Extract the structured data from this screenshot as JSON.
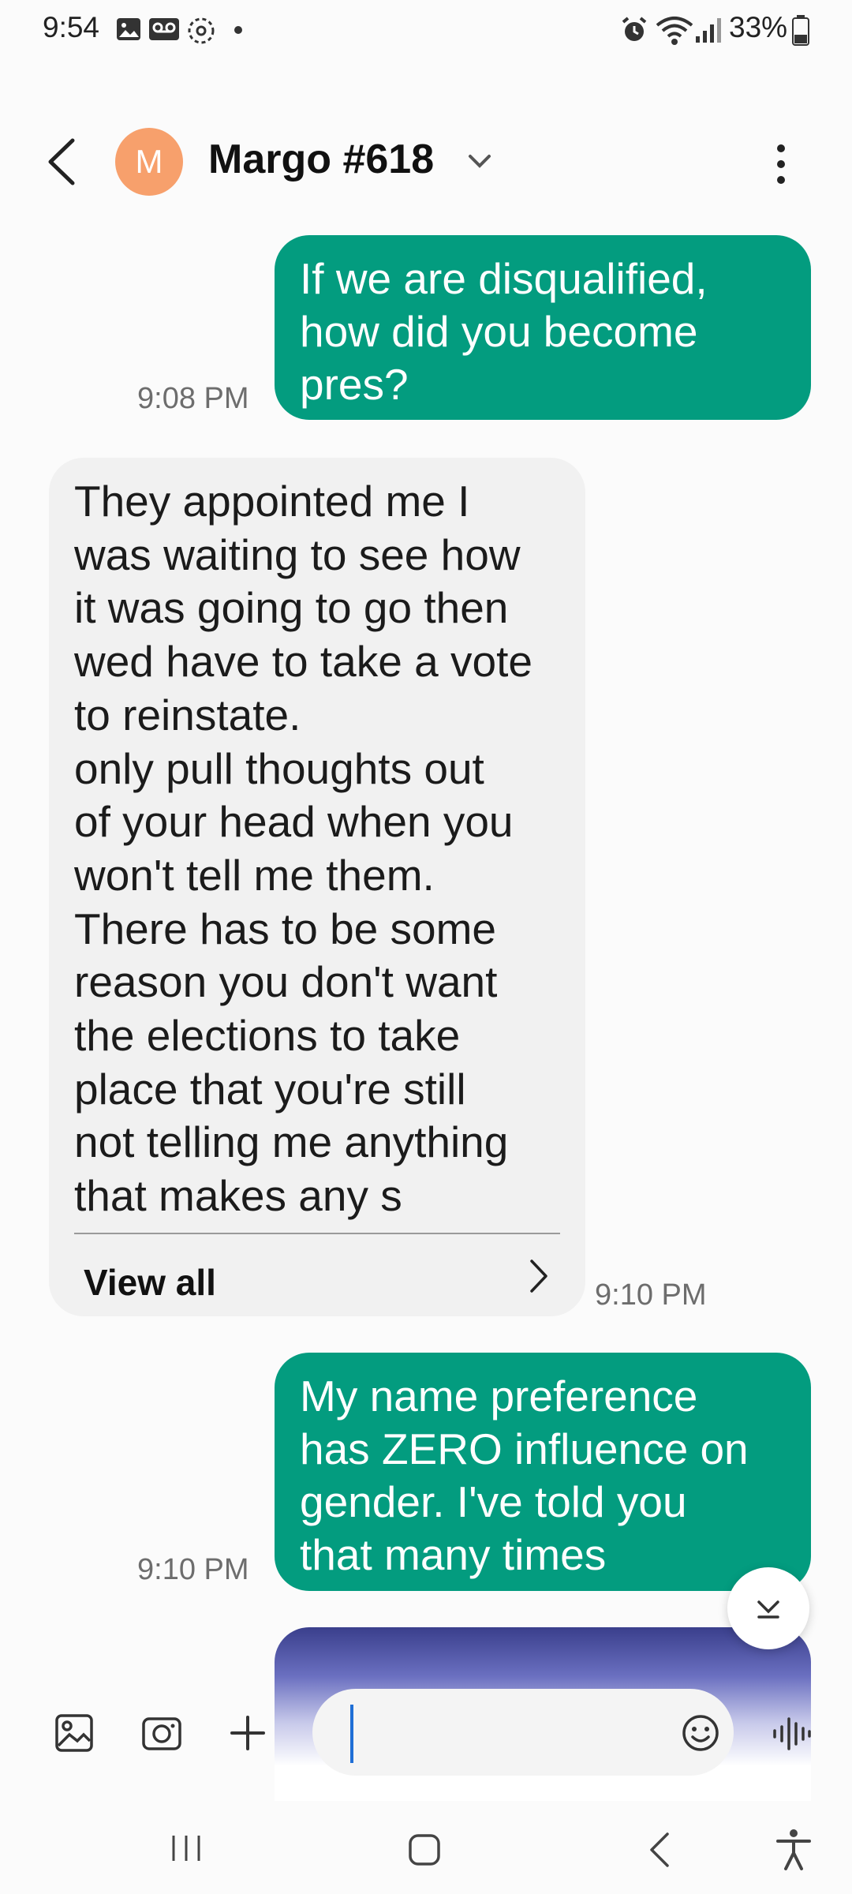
{
  "status_bar": {
    "time": "9:54",
    "battery_percent": "33%",
    "icons": [
      "gallery-icon",
      "voicemail-icon",
      "sync-icon",
      "dot-icon",
      "alarm-icon",
      "wifi-icon",
      "signal-icon",
      "battery-icon"
    ]
  },
  "header": {
    "avatar_letter": "M",
    "contact_name": "Margo #618",
    "avatar_color": "#f7a06c"
  },
  "messages": [
    {
      "direction": "outgoing",
      "lines": [
        "If we are disqualified,",
        "how did you become",
        "pres?"
      ],
      "time": "9:08 PM"
    },
    {
      "direction": "incoming",
      "lines": [
        "They appointed me I",
        "was waiting to see how",
        "it was going to go then",
        "wed have to take a vote",
        "to reinstate.",
        "only pull thoughts out",
        "of your head when you",
        "won't tell me them.",
        "There has to be some",
        "reason you don't want",
        "the elections to take",
        "place that you're still",
        "not telling me anything",
        "that makes any s"
      ],
      "view_all_label": "View all",
      "time": "9:10 PM"
    },
    {
      "direction": "outgoing",
      "lines": [
        "My name preference",
        "has ZERO influence on",
        "gender. I've told you",
        "that many times"
      ],
      "time": "9:10 PM"
    }
  ],
  "colors": {
    "outgoing_bubble": "#039c7f",
    "incoming_bubble": "#f1f1f1",
    "accent_cursor": "#1f6fd6"
  }
}
